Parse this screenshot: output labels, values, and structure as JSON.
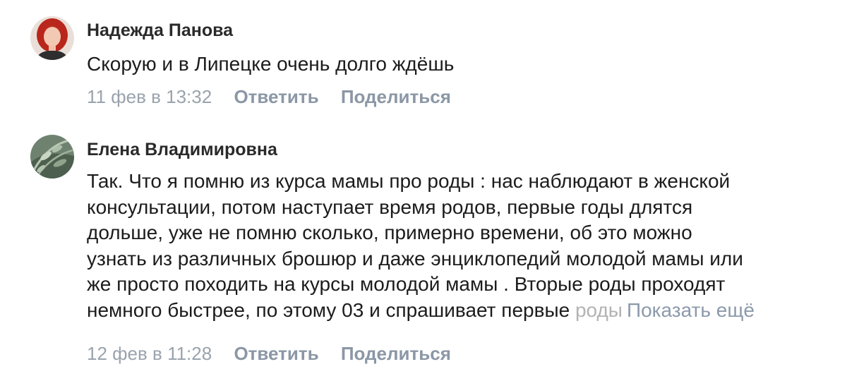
{
  "comments": [
    {
      "author": "Надежда Панова",
      "avatar_icon": "user-photo-red-hair",
      "text_lines": [
        "Скорую и в Липецке очень долго ждёшь"
      ],
      "time": "11 фев в 13:32",
      "reply_label": "Ответить",
      "share_label": "Поделиться"
    },
    {
      "author": "Елена Владимировна",
      "avatar_icon": "user-photo-plant",
      "text_lines": [
        "Так. Что я помню из курса мамы про роды : нас наблюдают в женской",
        "консультации, потом наступает время родов, первые годы длятся",
        "дольше, уже не помню сколько, примерно времени, об это можно",
        "узнать из различных брошюр и даже энциклопедий молодой мамы или",
        "же просто походить на курсы молодой мамы . Вторые роды проходят"
      ],
      "last_line_visible": "немного быстрее, по этому 03 и спрашивает первые ",
      "last_line_faded": "роды",
      "show_more_label": "Показать ещё",
      "time": "12 фев в 11:28",
      "reply_label": "Ответить",
      "share_label": "Поделиться"
    }
  ],
  "colors": {
    "author": "#2a2a2a",
    "text": "#1c1c1c",
    "meta_time": "#9aa3ad",
    "meta_action": "#8b97a5",
    "show_more": "#8c9aab"
  }
}
